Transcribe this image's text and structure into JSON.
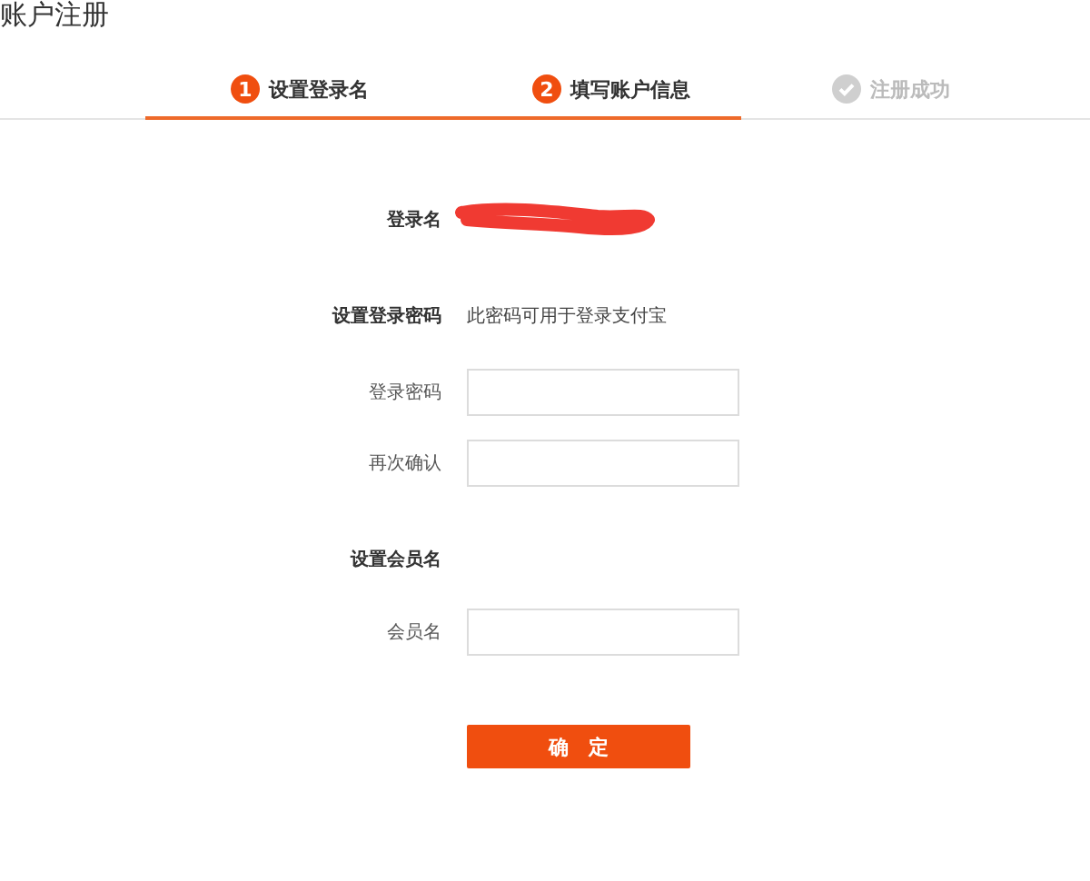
{
  "page_title": "账户注册",
  "steps": [
    {
      "number": "1",
      "label": "设置登录名",
      "active": true,
      "kind": "number"
    },
    {
      "number": "2",
      "label": "填写账户信息",
      "active": true,
      "kind": "number"
    },
    {
      "label": "注册成功",
      "active": false,
      "kind": "check"
    }
  ],
  "rows": [
    {
      "kind": "redacted",
      "label": "登录名"
    },
    {
      "kind": "note",
      "label": "设置登录密码",
      "note": "此密码可用于登录支付宝"
    },
    {
      "kind": "field",
      "label": "登录密码"
    },
    {
      "kind": "field",
      "label": "再次确认"
    },
    {
      "kind": "heading",
      "label": "设置会员名"
    },
    {
      "kind": "field",
      "label": "会员名"
    }
  ],
  "submit_button": "确　定"
}
